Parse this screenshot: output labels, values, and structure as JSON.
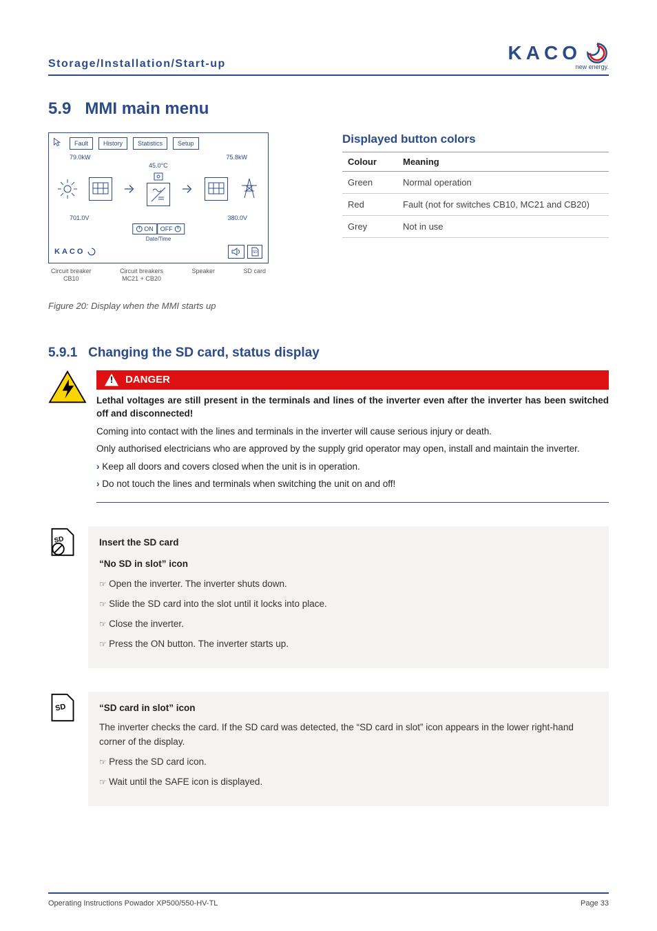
{
  "header": {
    "breadcrumb": "Storage/Installation/Start-up"
  },
  "logo": {
    "text": "KACO",
    "sub": "new energy."
  },
  "section": {
    "number": "5.9",
    "title": "MMI main menu"
  },
  "mmi": {
    "tabs": [
      "Fault",
      "History",
      "Statistics",
      "Setup"
    ],
    "reading_left_kw": "79.0kW",
    "reading_right_kw": "75.8kW",
    "reading_temp": "45.0°C",
    "reading_left_v": "701.0V",
    "reading_right_v": "380.0V",
    "kaco": "KACO",
    "on": "ON",
    "off": "OFF",
    "date_time_label": "Date/Time",
    "labels": {
      "cb10a": "Circuit breaker",
      "cb10b": "CB10",
      "mc21a": "Circuit breakers",
      "mc21b": "MC21 + CB20",
      "speaker": "Speaker",
      "sdcard": "SD card"
    }
  },
  "figure_caption": "Figure 20:  Display when the MMI starts up",
  "colors_table": {
    "heading": "Displayed button colors",
    "col1": "Colour",
    "col2": "Meaning",
    "rows": [
      {
        "colour": "Green",
        "meaning": "Normal operation"
      },
      {
        "colour": "Red",
        "meaning": "Fault (not for switches CB10, MC21 and CB20)"
      },
      {
        "colour": "Grey",
        "meaning": "Not in use"
      }
    ]
  },
  "subsection": {
    "number": "5.9.1",
    "title": "Changing the SD card, status display"
  },
  "danger": {
    "label": "DANGER",
    "p1": "Lethal voltages are still present in the terminals and lines of the inverter even after the inverter has been switched off and disconnected!",
    "p2": "Coming into contact with the lines and terminals in the inverter will cause serious injury or death.",
    "p3": "Only authorised electricians who are approved by the supply grid operator may open, install and maintain the inverter.",
    "b1": "Keep all doors and covers closed when the unit is in operation.",
    "b2": "Do not touch the lines and terminals when switching the unit on and off!"
  },
  "insert_sd": {
    "title": "Insert the SD card",
    "icon_title": "“No SD in slot” icon",
    "s1": "Open the inverter. The inverter shuts down.",
    "s2": "Slide the SD card into the slot until it locks into place.",
    "s3": "Close the inverter.",
    "s4": "Press the ON button. The inverter starts up."
  },
  "sd_in_slot": {
    "icon_title": "“SD card in slot” icon",
    "p1": "The inverter checks the card. If the SD card was detected, the “SD card in slot” icon appears in the lower right-hand corner of the display.",
    "s1": "Press the SD card icon.",
    "s2": "Wait until the SAFE icon is displayed."
  },
  "footer": {
    "left": "Operating Instructions Powador XP500/550-HV-TL",
    "right": "Page 33"
  }
}
